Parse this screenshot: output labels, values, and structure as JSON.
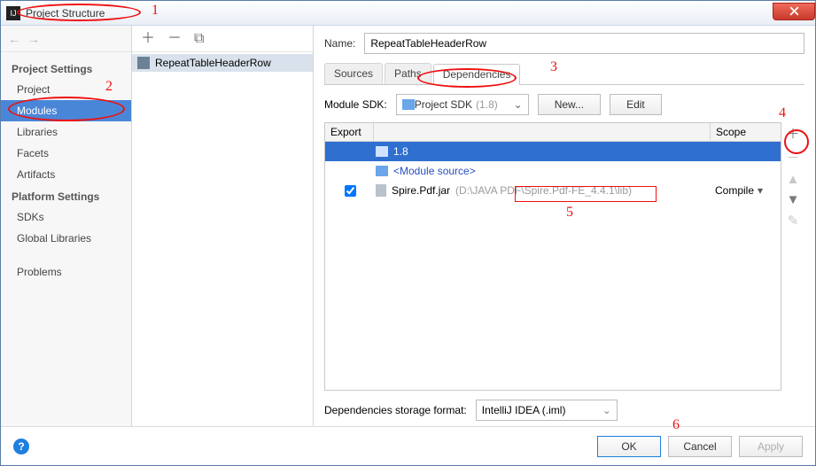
{
  "window": {
    "title": "Project Structure"
  },
  "sidebar": {
    "sections": [
      {
        "header": "Project Settings",
        "items": [
          "Project",
          "Modules",
          "Libraries",
          "Facets",
          "Artifacts"
        ],
        "selected": 1
      },
      {
        "header": "Platform Settings",
        "items": [
          "SDKs",
          "Global Libraries"
        ]
      },
      {
        "header": "",
        "items": [
          "Problems"
        ]
      }
    ]
  },
  "modules": {
    "items": [
      "RepeatTableHeaderRow"
    ]
  },
  "main": {
    "nameLabel": "Name:",
    "nameValue": "RepeatTableHeaderRow",
    "tabs": [
      "Sources",
      "Paths",
      "Dependencies"
    ],
    "activeTab": 2,
    "sdkLabel": "Module SDK:",
    "sdkValue": "Project SDK",
    "sdkVersion": "(1.8)",
    "newBtn": "New...",
    "editBtn": "Edit",
    "columns": {
      "export": "Export",
      "scope": "Scope"
    },
    "deps": [
      {
        "kind": "sdk",
        "label": "1.8"
      },
      {
        "kind": "module",
        "label": "<Module source>"
      },
      {
        "kind": "jar",
        "label": "Spire.Pdf.jar",
        "path": "(D:\\JAVA PDF\\Spire.Pdf-FE_4.4.1\\lib)",
        "checked": true,
        "scope": "Compile"
      }
    ],
    "storageLabel": "Dependencies storage format:",
    "storageValue": "IntelliJ IDEA (.iml)"
  },
  "buttons": {
    "ok": "OK",
    "cancel": "Cancel",
    "apply": "Apply"
  }
}
